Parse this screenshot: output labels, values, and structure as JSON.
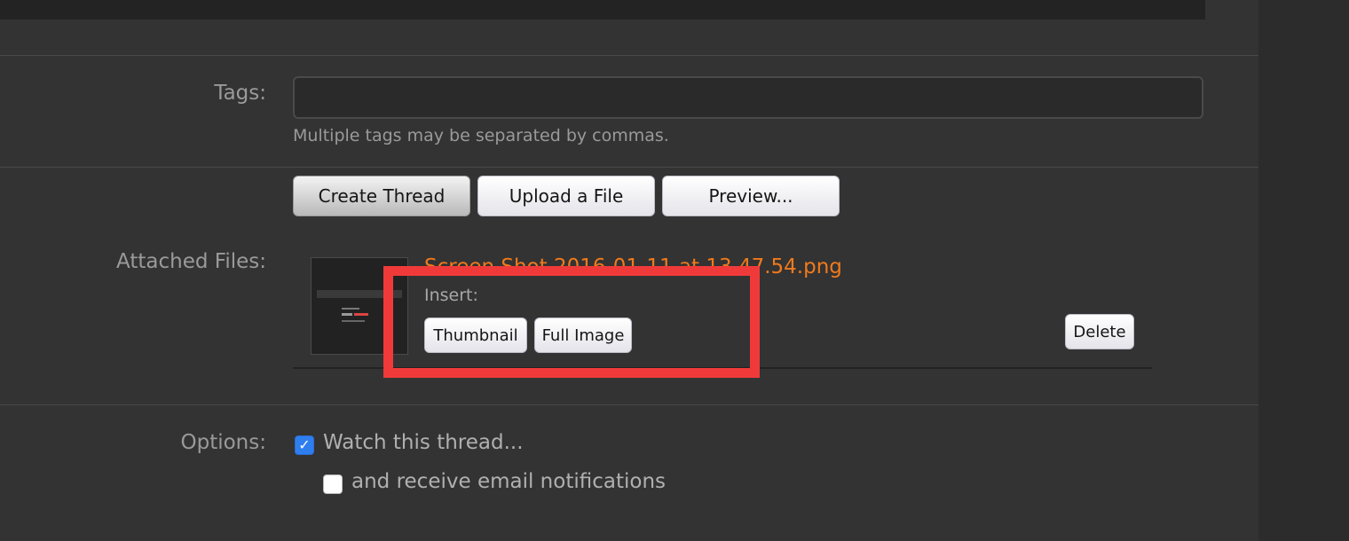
{
  "tags": {
    "label": "Tags:",
    "value": "",
    "placeholder": "",
    "hint": "Multiple tags may be separated by commas."
  },
  "actions": {
    "create_thread": "Create Thread",
    "upload_file": "Upload a File",
    "preview": "Preview..."
  },
  "attachments": {
    "label": "Attached Files:",
    "files": [
      {
        "name": "Screen Shot 2016-01-11 at 13.47.54.png",
        "insert_label": "Insert:",
        "thumbnail_button": "Thumbnail",
        "full_image_button": "Full Image",
        "delete_button": "Delete"
      }
    ]
  },
  "options": {
    "label": "Options:",
    "watch_thread": {
      "label": "Watch this thread...",
      "checked": true
    },
    "email_notifications": {
      "label": "and receive email notifications",
      "checked": false
    }
  },
  "colors": {
    "accent_link": "#f07a1c",
    "highlight_box": "#f03a3a",
    "checkbox_checked": "#2f7ef0"
  }
}
